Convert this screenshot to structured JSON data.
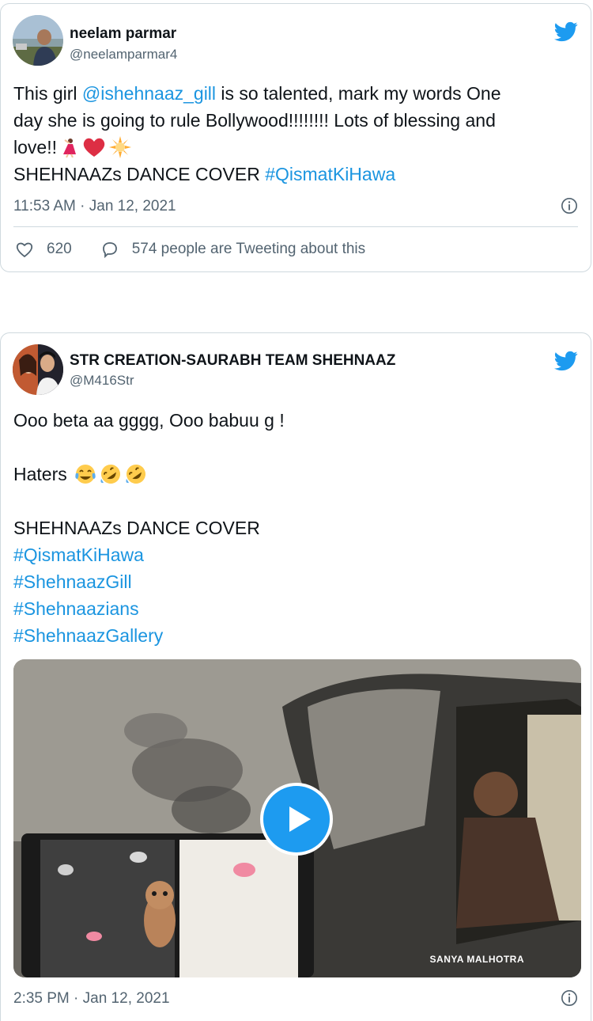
{
  "tweets": [
    {
      "name": "neelam parmar",
      "handle": "@neelamparmar4",
      "text": {
        "l1_pre": "This girl ",
        "l1_mention": "@ishehnaaz_gill",
        "l1_post": " is so talented, mark my words One",
        "l2": "day she is going to rule Bollywood!!!!!!!! Lots of blessing and",
        "l3": "love!!",
        "l4_pre": "SHEHNAAZs DANCE COVER ",
        "l4_tag": "#QismatKiHawa"
      },
      "emojis": [
        "dancer-emoji",
        "red-heart-emoji",
        "sun-emoji"
      ],
      "timestamp": "11:53 AM · Jan 12, 2021",
      "likes": "620",
      "tweeting": "574 people are Tweeting about this"
    },
    {
      "name": "STR CREATION-SAURABH TEAM SHEHNAAZ",
      "handle": "@M416Str",
      "text": {
        "l1": "Ooo beta aa gggg, Ooo babuu g !",
        "l2": "Haters",
        "l3": "SHEHNAAZs DANCE COVER",
        "tags": [
          "#QismatKiHawa",
          "#ShehnaazGill",
          "#Shehnaazians",
          "#ShehnaazGallery"
        ]
      },
      "emojis": [
        "tears-of-joy-emoji",
        "rofl-emoji",
        "rofl-emoji"
      ],
      "media_watermark": "SANYA MALHOTRA",
      "timestamp": "2:35 PM · Jan 12, 2021"
    }
  ],
  "colors": {
    "link": "#1b95e0",
    "twitter_blue": "#1d9bf0",
    "secondary_text": "#536471",
    "border": "#cfd9de"
  }
}
